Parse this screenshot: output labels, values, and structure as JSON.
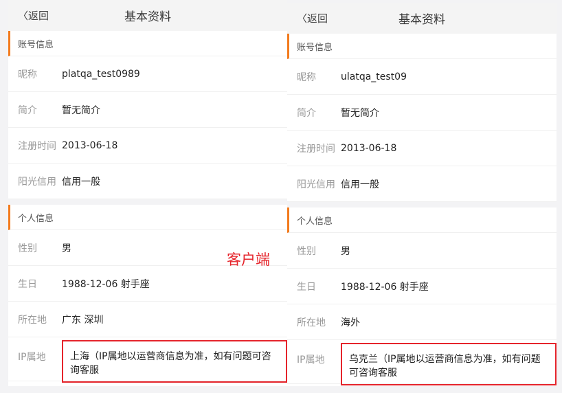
{
  "annotation": "客户端",
  "panels": [
    {
      "back": "返回",
      "title": "基本资料",
      "account_section": "账号信息",
      "account_rows": [
        {
          "label": "昵称",
          "value": "platqa_test0989"
        },
        {
          "label": "简介",
          "value": "暂无简介"
        },
        {
          "label": "注册时间",
          "value": "2013-06-18"
        },
        {
          "label": "阳光信用",
          "value": "信用一般"
        }
      ],
      "personal_section": "个人信息",
      "personal_rows": [
        {
          "label": "性别",
          "value": "男"
        },
        {
          "label": "生日",
          "value": "1988-12-06 射手座"
        },
        {
          "label": "所在地",
          "value": "广东 深圳"
        }
      ],
      "ip": {
        "label": "IP属地",
        "value": "上海（IP属地以运营商信息为准，如有问题可咨询客服"
      }
    },
    {
      "back": "返回",
      "title": "基本资料",
      "account_section": "账号信息",
      "account_rows": [
        {
          "label": "昵称",
          "value": "ulatqa_test09"
        },
        {
          "label": "简介",
          "value": "暂无简介"
        },
        {
          "label": "注册时间",
          "value": "2013-06-18"
        },
        {
          "label": "阳光信用",
          "value": "信用一般"
        }
      ],
      "personal_section": "个人信息",
      "personal_rows": [
        {
          "label": "性别",
          "value": "男"
        },
        {
          "label": "生日",
          "value": "1988-12-06 射手座"
        },
        {
          "label": "所在地",
          "value": "海外"
        }
      ],
      "ip": {
        "label": "IP属地",
        "value": "乌克兰（IP属地以运营商信息为准，如有问题可咨询客服"
      }
    }
  ]
}
